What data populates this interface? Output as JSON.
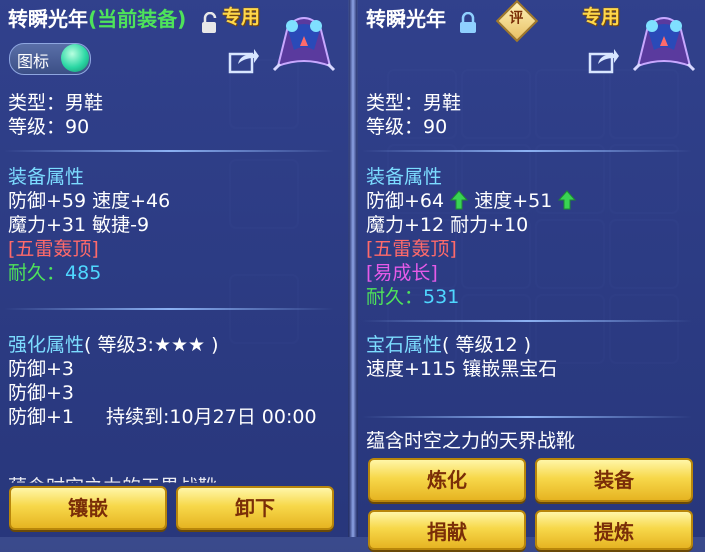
{
  "left": {
    "title": "转瞬光年",
    "status": "(当前装备)",
    "badge": "专用",
    "toggle_label": "图标",
    "type_line": "类型：男鞋",
    "level_line": "等级：90",
    "attr_header": "装备属性",
    "attr_line1": "防御+59 速度+46",
    "attr_line2": "魔力+31 敏捷-9",
    "special": "[五雷轰顶]",
    "durability_label": "耐久：",
    "durability_value": "485",
    "enhance_header": "强化属性",
    "enhance_level": "( 等级3:★★★ )",
    "enhance_line1": "防御+3",
    "enhance_line2": "防御+3",
    "enhance_line3": "防御+1",
    "enhance_duration": "持续到:10月27日 00:00",
    "cut_text": "蕴含时空之力的天界战靴",
    "buttons": {
      "inlay": "镶嵌",
      "unequip": "卸下"
    }
  },
  "right": {
    "title": "转瞬光年",
    "badge": "专用",
    "review_badge": "评",
    "type_line": "类型：男鞋",
    "level_line": "等级：90",
    "attr_header": "装备属性",
    "attr_def": "防御+64",
    "attr_spd": "速度+51",
    "attr_line2": "魔力+12 耐力+10",
    "special1": "[五雷轰顶]",
    "special2": "[易成长]",
    "durability_label": "耐久：",
    "durability_value": "531",
    "gem_header": "宝石属性",
    "gem_level": "( 等级12 )",
    "gem_line": "速度+115 镶嵌黑宝石",
    "description": "蕴含时空之力的天界战靴",
    "buttons": {
      "refine": "炼化",
      "equip": "装备",
      "donate": "捐献",
      "extract": "提炼"
    }
  },
  "colors": {
    "up_arrow": "#39d353",
    "button_text": "#7a2e08",
    "badge": "#ffd84a"
  },
  "icons": [
    "lock-open-icon",
    "lock-closed-icon",
    "share-icon",
    "boots-item-icon",
    "up-arrow-icon",
    "review-icon"
  ]
}
